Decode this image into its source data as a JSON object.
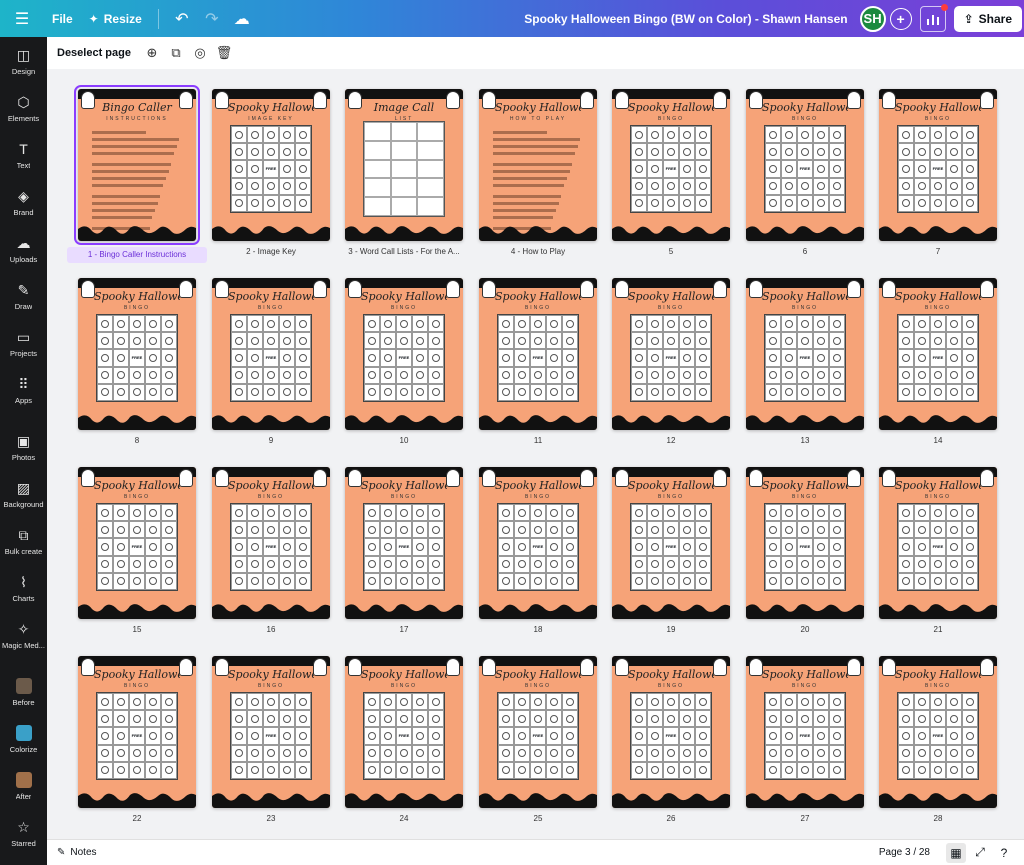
{
  "topbar": {
    "file_label": "File",
    "resize_label": "Resize",
    "doc_title": "Spooky Halloween Bingo (BW on Color) - Shawn Hansen",
    "avatar_initials": "SH",
    "share_label": "Share",
    "gradient_colors": [
      "#1eb4c9",
      "#2f86d8",
      "#5a4fd9",
      "#7b3fd8"
    ]
  },
  "sidebar": {
    "items": [
      {
        "label": "Design",
        "icon": "layout-icon"
      },
      {
        "label": "Elements",
        "icon": "shapes-icon"
      },
      {
        "label": "Text",
        "icon": "text-icon"
      },
      {
        "label": "Brand",
        "icon": "brand-icon"
      },
      {
        "label": "Uploads",
        "icon": "cloud-upload-icon"
      },
      {
        "label": "Draw",
        "icon": "pen-icon"
      },
      {
        "label": "Projects",
        "icon": "folder-icon"
      },
      {
        "label": "Apps",
        "icon": "apps-grid-icon"
      },
      {
        "label": "Photos",
        "icon": "photo-icon"
      },
      {
        "label": "Background",
        "icon": "background-icon"
      },
      {
        "label": "Bulk create",
        "icon": "bulk-create-icon"
      },
      {
        "label": "Charts",
        "icon": "chart-icon"
      },
      {
        "label": "Magic Med...",
        "icon": "magic-media-icon"
      },
      {
        "label": "Before",
        "icon": "before-thumb"
      },
      {
        "label": "Colorize",
        "icon": "colorize-thumb"
      },
      {
        "label": "After",
        "icon": "after-thumb"
      },
      {
        "label": "Starred",
        "icon": "star-icon"
      }
    ]
  },
  "toolbar": {
    "deselect_label": "Deselect page"
  },
  "pages": [
    {
      "label": "1 - Bingo Caller Instructions",
      "title": "Bingo Caller",
      "sub": "INSTRUCTIONS",
      "kind": "text"
    },
    {
      "label": "2 - Image Key",
      "title": "Spooky Halloween",
      "sub": "IMAGE KEY",
      "kind": "grid"
    },
    {
      "label": "3 - Word Call Lists - For the A...",
      "title": "Image Call",
      "sub": "LIST",
      "kind": "list"
    },
    {
      "label": "4 - How to Play",
      "title": "Spooky Halloween",
      "sub": "HOW TO PLAY",
      "kind": "text"
    },
    {
      "label": "5",
      "title": "Spooky Halloween",
      "sub": "BINGO",
      "kind": "grid"
    },
    {
      "label": "6",
      "title": "Spooky Halloween",
      "sub": "BINGO",
      "kind": "grid"
    },
    {
      "label": "7",
      "title": "Spooky Halloween",
      "sub": "BINGO",
      "kind": "grid"
    },
    {
      "label": "8",
      "title": "Spooky Halloween",
      "sub": "BINGO",
      "kind": "grid"
    },
    {
      "label": "9",
      "title": "Spooky Halloween",
      "sub": "BINGO",
      "kind": "grid"
    },
    {
      "label": "10",
      "title": "Spooky Halloween",
      "sub": "BINGO",
      "kind": "grid"
    },
    {
      "label": "11",
      "title": "Spooky Halloween",
      "sub": "BINGO",
      "kind": "grid"
    },
    {
      "label": "12",
      "title": "Spooky Halloween",
      "sub": "BINGO",
      "kind": "grid"
    },
    {
      "label": "13",
      "title": "Spooky Halloween",
      "sub": "BINGO",
      "kind": "grid"
    },
    {
      "label": "14",
      "title": "Spooky Halloween",
      "sub": "BINGO",
      "kind": "grid"
    },
    {
      "label": "15",
      "title": "Spooky Halloween",
      "sub": "BINGO",
      "kind": "grid"
    },
    {
      "label": "16",
      "title": "Spooky Halloween",
      "sub": "BINGO",
      "kind": "grid"
    },
    {
      "label": "17",
      "title": "Spooky Halloween",
      "sub": "BINGO",
      "kind": "grid"
    },
    {
      "label": "18",
      "title": "Spooky Halloween",
      "sub": "BINGO",
      "kind": "grid"
    },
    {
      "label": "19",
      "title": "Spooky Halloween",
      "sub": "BINGO",
      "kind": "grid"
    },
    {
      "label": "20",
      "title": "Spooky Halloween",
      "sub": "BINGO",
      "kind": "grid"
    },
    {
      "label": "21",
      "title": "Spooky Halloween",
      "sub": "BINGO",
      "kind": "grid"
    },
    {
      "label": "22",
      "title": "Spooky Halloween",
      "sub": "BINGO",
      "kind": "grid"
    },
    {
      "label": "23",
      "title": "Spooky Halloween",
      "sub": "BINGO",
      "kind": "grid"
    },
    {
      "label": "24",
      "title": "Spooky Halloween",
      "sub": "BINGO",
      "kind": "grid"
    },
    {
      "label": "25",
      "title": "Spooky Halloween",
      "sub": "BINGO",
      "kind": "grid"
    },
    {
      "label": "26",
      "title": "Spooky Halloween",
      "sub": "BINGO",
      "kind": "grid"
    },
    {
      "label": "27",
      "title": "Spooky Halloween",
      "sub": "BINGO",
      "kind": "grid"
    },
    {
      "label": "28",
      "title": "Spooky Halloween",
      "sub": "BINGO",
      "kind": "grid"
    }
  ],
  "free_label": "FREE",
  "selected_page": 1,
  "bottombar": {
    "notes_label": "Notes",
    "page_indicator": "Page 3 / 28"
  },
  "colors": {
    "page_orange": "#f6a378",
    "select_purple": "#8b3dff",
    "sidebar_bg": "#18191b"
  }
}
